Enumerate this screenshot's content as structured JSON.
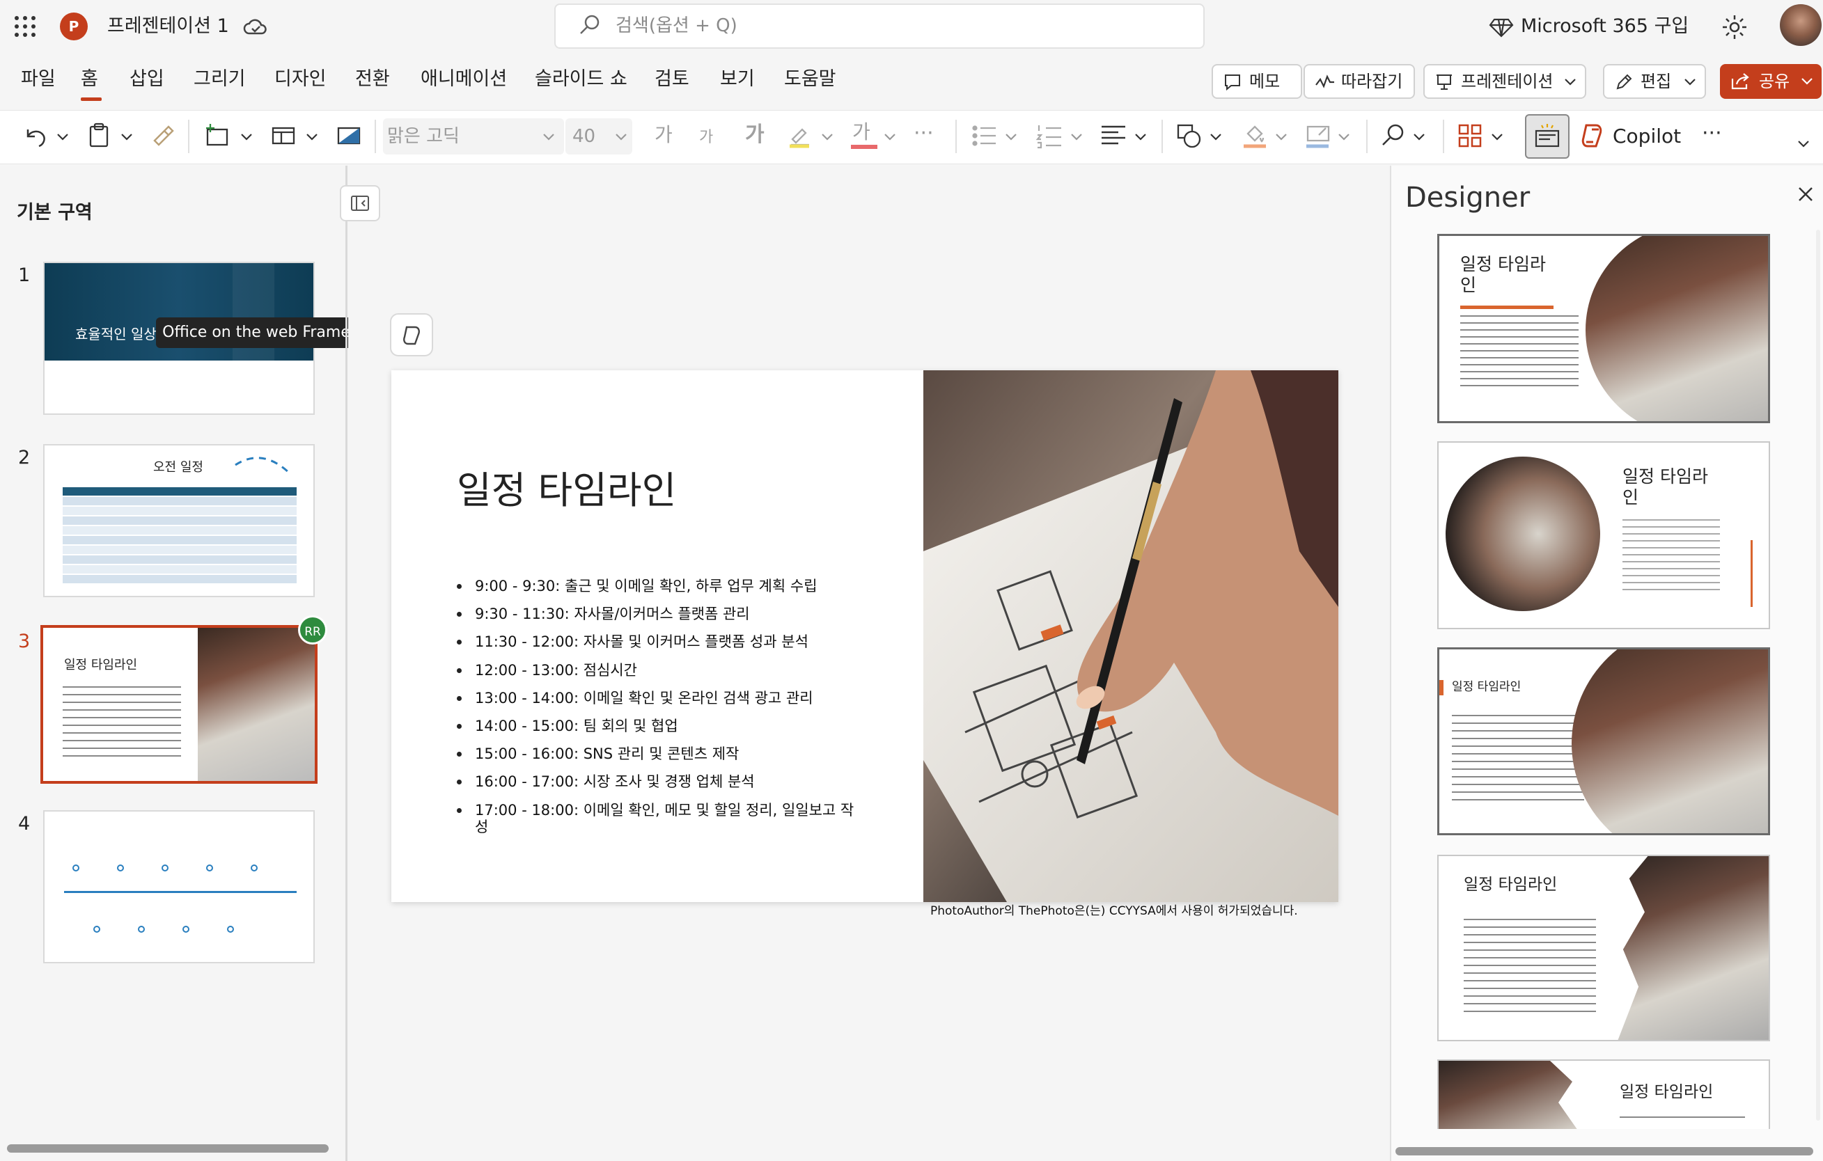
{
  "app": {
    "doc_title": "프레젠테이션 1",
    "search_placeholder": "검색(옵션 + Q)",
    "m365": "Microsoft 365 구입",
    "logo_letter": "P"
  },
  "menu": [
    "파일",
    "홈",
    "삽입",
    "그리기",
    "디자인",
    "전환",
    "애니메이션",
    "슬라이드 쇼",
    "검토",
    "보기",
    "도움말"
  ],
  "actions": {
    "memo": "메모",
    "follow": "따라잡기",
    "present": "프레젠테이션",
    "edit": "편집",
    "share": "공유"
  },
  "ribbon": {
    "font_name": "맑은 고딕",
    "font_size": "40",
    "grow": "가",
    "shrink": "가",
    "bold": "가",
    "font_color_glyph": "가",
    "copilot": "Copilot",
    "more": "···"
  },
  "left_pane": {
    "section": "기본 구역",
    "tooltip": "Office on the web Frame",
    "avatar_badge": "RR",
    "slides": [
      {
        "num": "1",
        "title": "효율적인 일상"
      },
      {
        "num": "2",
        "title": "오전 일정"
      },
      {
        "num": "3",
        "title": "일정 타임라인"
      },
      {
        "num": "4",
        "title": ""
      }
    ]
  },
  "slide": {
    "title": "일정 타임라인",
    "bullets": [
      "9:00 - 9:30: 출근 및 이메일 확인, 하루 업무 계획 수립",
      "9:30 - 11:30: 자사몰/이커머스 플랫폼 관리",
      "11:30 - 12:00: 자사몰 및 이커머스 플랫폼 성과 분석",
      "12:00 - 13:00: 점심시간",
      "13:00 - 14:00: 이메일 확인 및 온라인 검색 광고 관리",
      "14:00 - 15:00: 팀 회의 및 협업",
      "15:00 - 16:00: SNS 관리 및 콘텐츠 제작",
      "16:00 - 17:00: 시장 조사 및 경쟁 업체 분석",
      "17:00 - 18:00: 이메일 확인, 메모 및 할일 정리, 일일보고 작",
      "성"
    ],
    "credit": "PhotoAuthor의 ThePhoto은(는) CCYYSA에서 사용이 허가되었습니다."
  },
  "designer": {
    "title": "Designer",
    "card_titles": [
      "일정 타임라",
      "인",
      "일정 타임라",
      "인",
      "일정 타임라인",
      "일정 타임라인",
      "일정 타임라인"
    ]
  },
  "colors": {
    "accent": "#c43e1c",
    "slide_dark": "#0f3d55",
    "badge": "#2e8b3e"
  }
}
